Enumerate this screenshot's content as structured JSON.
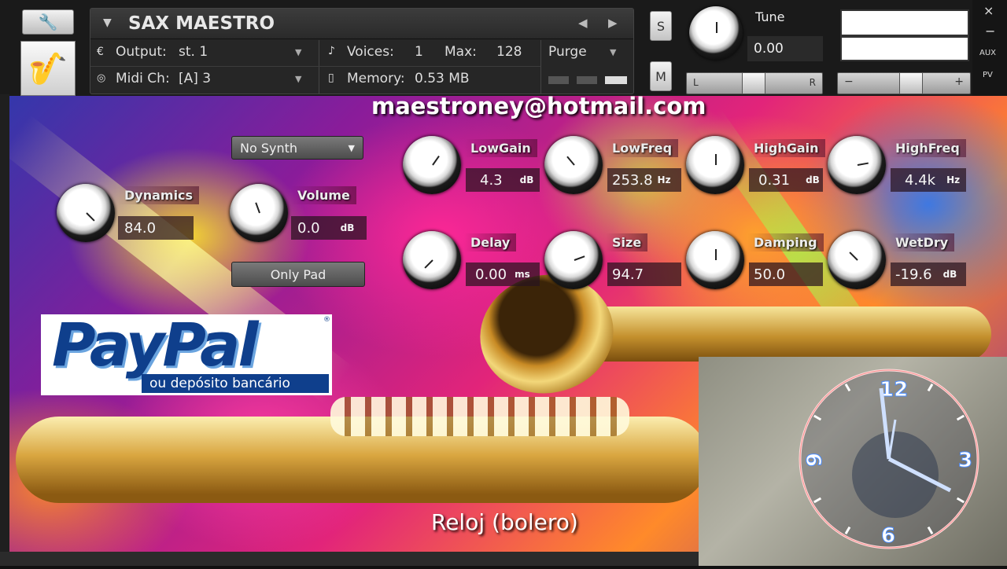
{
  "instrument": {
    "name": "SAX MAESTRO",
    "output_label": "Output:",
    "output_value": "st. 1",
    "midi_label": "Midi Ch:",
    "midi_value": "[A]  3",
    "voices_label": "Voices:",
    "voices_value": "1",
    "max_label": "Max:",
    "max_value": "128",
    "memory_label": "Memory:",
    "memory_value": "0.53 MB",
    "purge_label": "Purge",
    "solo_label": "S",
    "mute_label": "M",
    "tune_label": "Tune",
    "tune_value": "0.00",
    "pan_left": "L",
    "pan_right": "R",
    "vol_minus": "−",
    "vol_plus": "+",
    "right_labels": [
      "×",
      "−",
      "AUX",
      "PV"
    ]
  },
  "overlay": {
    "email": "maestroney@hotmail.com",
    "song_title": "Reloj (bolero)",
    "paypal_main": "PayPal",
    "paypal_sub": "ou depósito bancário",
    "paypal_reg": "®"
  },
  "controls": {
    "synth_menu": "No Synth",
    "only_pad": "Only Pad",
    "dynamics": {
      "label": "Dynamics",
      "value": "84.0",
      "unit": ""
    },
    "volume": {
      "label": "Volume",
      "value": "0.0",
      "unit": "dB"
    },
    "lowgain": {
      "label": "LowGain",
      "value": "4.3",
      "unit": "dB"
    },
    "lowfreq": {
      "label": "LowFreq",
      "value": "253.8",
      "unit": "Hz"
    },
    "highgain": {
      "label": "HighGain",
      "value": "0.31",
      "unit": "dB"
    },
    "highfreq": {
      "label": "HighFreq",
      "value": "4.4k",
      "unit": "Hz"
    },
    "delay": {
      "label": "Delay",
      "value": "0.00",
      "unit": "ms"
    },
    "size": {
      "label": "Size",
      "value": "94.7",
      "unit": ""
    },
    "damping": {
      "label": "Damping",
      "value": "50.0",
      "unit": ""
    },
    "wetdry": {
      "label": "WetDry",
      "value": "-19.6",
      "unit": "dB"
    }
  },
  "clock": {
    "numerals": [
      "12",
      "3",
      "6",
      "9"
    ]
  },
  "icons": {
    "wrench": "wrench-icon",
    "sax": "saxophone-icon",
    "output": "output-icon",
    "midi": "midi-icon",
    "voices": "voices-icon",
    "memory": "memory-icon"
  }
}
